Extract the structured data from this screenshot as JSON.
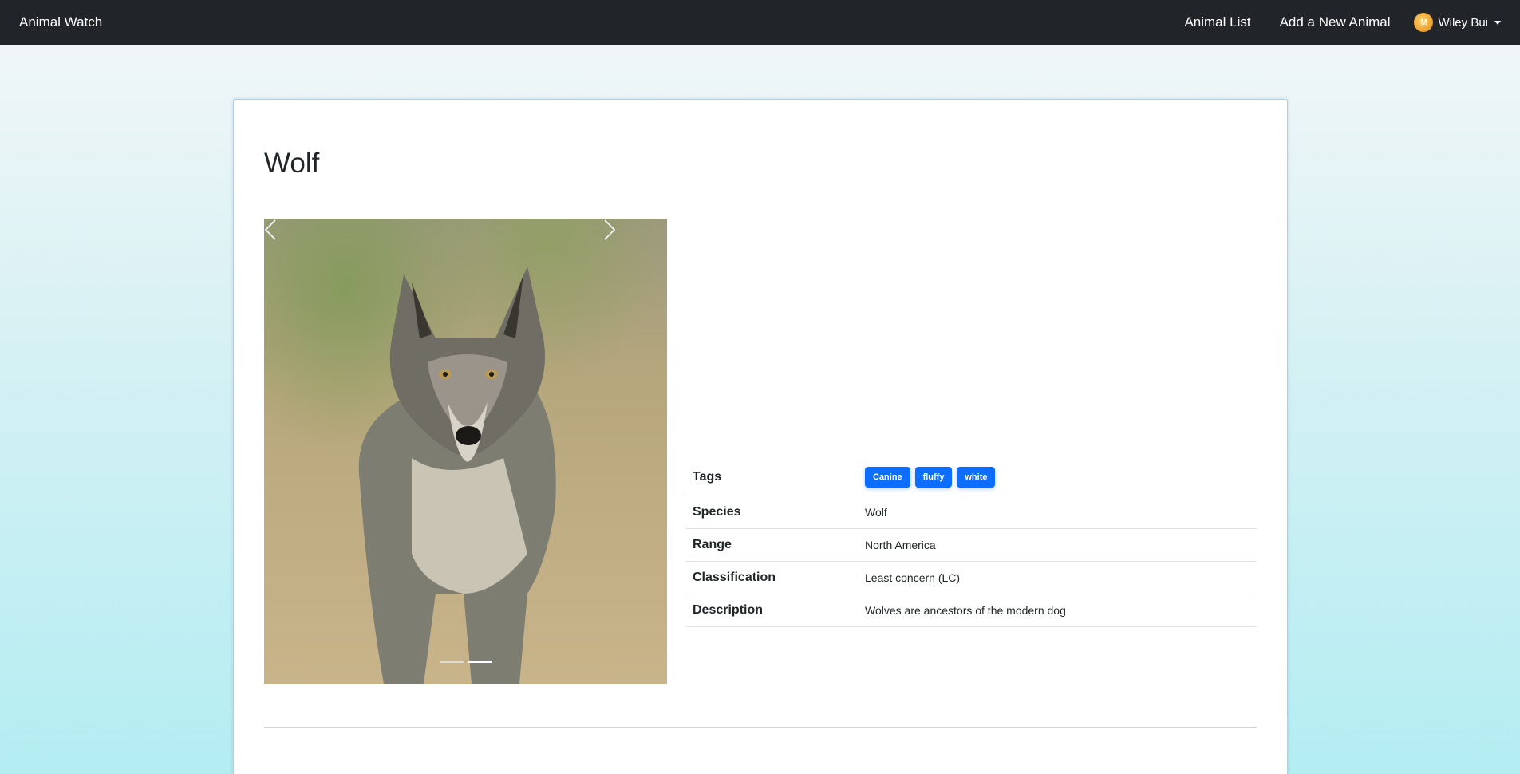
{
  "nav": {
    "brand": "Animal Watch",
    "links": [
      "Animal List",
      "Add a New Animal"
    ],
    "user": {
      "name": "Wiley Bui",
      "avatar_initials": "M"
    }
  },
  "animal": {
    "name": "Wolf",
    "carousel": {
      "slide_count": 2,
      "active_slide": 2,
      "prev_icon": "chevron-left-icon",
      "next_icon": "chevron-right-icon"
    },
    "details": {
      "tags_label": "Tags",
      "tags": [
        "Canine",
        "fluffy",
        "white"
      ],
      "species_label": "Species",
      "species": "Wolf",
      "range_label": "Range",
      "range": "North America",
      "classification_label": "Classification",
      "classification": "Least concern (LC)",
      "description_label": "Description",
      "description": "Wolves are ancestors of the modern dog"
    }
  },
  "colors": {
    "navbar": "#212529",
    "tag": "#0d6efd"
  }
}
